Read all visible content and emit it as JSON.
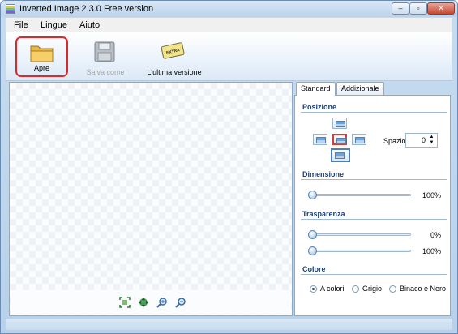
{
  "window": {
    "title": "Inverted Image 2.3.0 Free version",
    "minimize_glyph": "–",
    "maximize_glyph": "▫",
    "close_glyph": "✕"
  },
  "menu": {
    "file": "File",
    "lingue": "Lingue",
    "aiuto": "Aiuto"
  },
  "toolbar": {
    "open_label": "Apre",
    "save_as_label": "Salva come",
    "latest_version_label": "L'ultima versione",
    "badge_text": "EXTRA"
  },
  "canvas_tools": [
    "fit-icon",
    "move-icon",
    "zoom-in-icon",
    "zoom-out-icon"
  ],
  "tabs": {
    "standard": "Standard",
    "additional": "Addizionale"
  },
  "posizione": {
    "title": "Posizione",
    "spazio_label": "Spazio",
    "spazio_value": "0",
    "selected_position": "center"
  },
  "dimensione": {
    "title": "Dimensione",
    "value_label": "100%",
    "value": 100
  },
  "trasparenza": {
    "title": "Trasparenza",
    "value1_label": "0%",
    "value1": 0,
    "value2_label": "100%",
    "value2": 100
  },
  "colore": {
    "title": "Colore",
    "options": [
      "A colori",
      "Grigio",
      "Binaco e Nero"
    ],
    "selected": "A colori"
  },
  "colors": {
    "accent_highlight": "#e0262a",
    "section_title": "#1d3f72"
  }
}
